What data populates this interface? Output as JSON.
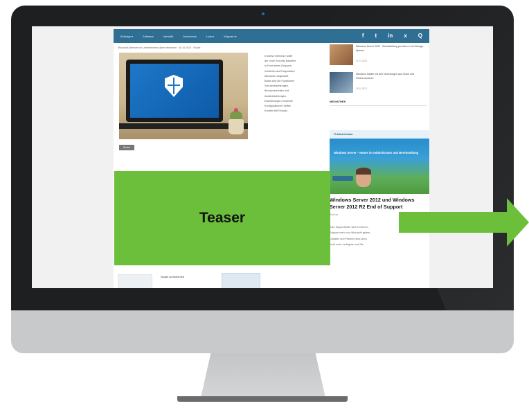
{
  "screen": {
    "navbar": {
      "items": [
        "Beiträge ▾",
        "Software",
        "Identität",
        "Downloads",
        "Lizenz",
        "Magazin ▾"
      ],
      "social_icons": [
        "facebook-icon",
        "twitter-icon",
        "linkedin-icon",
        "xing-icon",
        "search-icon"
      ],
      "social_glyphs": [
        "f",
        "t",
        "in",
        "x",
        "Q"
      ]
    },
    "breadcrumb": "Microsoft Defender im Unternehmen sicher einsetzen · 18.10.2023 · Studie",
    "article": {
      "body_lines": [
        "In Active Directory sollte",
        "der neue Security Baseline",
        "in Form eines Gruppen-",
        "richtlinien auf Endpunkten",
        "Microsoft umgesetzt,",
        "Basis sind die Funktionen",
        "Schutzeinstellungen,",
        "Benutzerrechten und",
        "Auditeinstellungen.",
        "Erweiterungen einzelner",
        "Konfigurationen helfen",
        "Kunden bei Einsatz."
      ],
      "tag": "Studie"
    },
    "sidebar": {
      "items": [
        {
          "title": "Windows Server 2022 · Bereitstellung per Azure und Storage Spaces",
          "date": "01.12.2023"
        },
        {
          "title": "Windows Insider mit den Neuerungen aus Cloud und Rechenzentrum",
          "date": "28.11.2023"
        }
      ],
      "heading": "MEDIATHEK",
      "promo_logo": "IT-Administrator",
      "promo_text": "Windows Server – Neues im Administrator und Bereitstellung",
      "headline": "Windows Server 2012 und Windows Server 2012 R2 End of Support",
      "sub": "Webinar",
      "body_lines": [
        "Zum Supportende wird es keinen",
        "Support mehr von Microsoft geben.",
        "Updates und Patches sind dann",
        "nicht mehr verfügbar und Sie"
      ]
    },
    "lower": {
      "title": "Studie zu Sicherheit"
    }
  },
  "teaser": {
    "label": "Teaser"
  },
  "colors": {
    "bezel": "#1e1f21",
    "chin": "#c8c9cb",
    "navbar": "#2f6f93",
    "teaser_green": "#6cbf3a"
  }
}
